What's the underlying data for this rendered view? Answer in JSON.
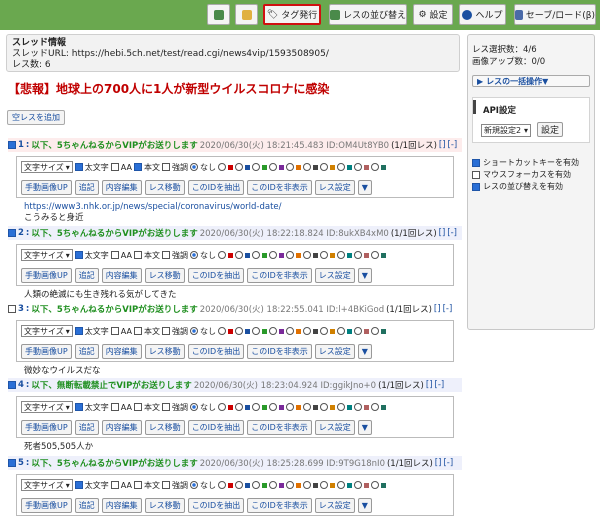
{
  "toolbar": {
    "items": [
      {
        "label": ""
      },
      {
        "label": ""
      },
      {
        "label": "タグ発行"
      },
      {
        "label": "レスの並び替え"
      },
      {
        "label": "設定"
      },
      {
        "label": "ヘルプ"
      },
      {
        "label": "セーブ/ロード(β)"
      }
    ]
  },
  "thread": {
    "info_title": "スレッド情報",
    "url_line": "スレッドURL: https://hebi.5ch.net/test/read.cgi/news4vip/1593508905/",
    "count_line": "レス数: 6",
    "title": "【悲報】地球上の700人に1人が新型ウイルスコロナに感染",
    "add_button": "空レスを追加"
  },
  "controls": {
    "font_select": "文字サイズ",
    "bold": "太文字",
    "aa": "AA",
    "honbun": "本文",
    "kyocho": "強調",
    "nashi": "なし",
    "buttons": [
      "手動画像UP",
      "追記",
      "内容編集",
      "レス移動",
      "このIDを抽出",
      "このIDを非表示",
      "レス設定"
    ],
    "more": "▼"
  },
  "colors": {
    "swatches": [
      "#cc0000",
      "#1a4fa0",
      "#2a9a2a",
      "#7a2a9a",
      "#e07000",
      "#444444",
      "#d08000",
      "#008080",
      "#b06060",
      "#207060"
    ]
  },
  "posts": [
    {
      "num": "1",
      "name": "以下、5ちゃんねるからVIPがお送りします",
      "datetime": "2020/06/30(火) 18:21:45.483 ID:OM4Ut8YB0",
      "rescount": "(1/1回レス)",
      "brackets": "[]",
      "minus": "[-]",
      "checked": true,
      "lines": [
        "https://www3.nhk.or.jp/news/special/coronavirus/world-date/",
        "こうみると身近"
      ]
    },
    {
      "num": "2",
      "name": "以下、5ちゃんねるからVIPがお送りします",
      "datetime": "2020/06/30(火) 18:22:18.824 ID:8ukXB4xM0",
      "rescount": "(1/1回レス)",
      "brackets": "[]",
      "minus": "[-]",
      "checked": true,
      "lines": [
        "人類の絶滅にも生き残れる気がしてきた"
      ]
    },
    {
      "num": "3",
      "name": "以下、5ちゃんねるからVIPがお送りします",
      "datetime": "2020/06/30(火) 18:22:55.041 ID:l+4BKiGod",
      "rescount": "(1/1回レス)",
      "brackets": "[]",
      "minus": "[-]",
      "checked": false,
      "lines": [
        "微妙なウイルスだな"
      ]
    },
    {
      "num": "4",
      "name": "以下、無断転載禁止でVIPがお送りします",
      "datetime": "2020/06/30(火) 18:23:04.924 ID:ggikJno+0",
      "rescount": "(1/1回レス)",
      "brackets": "[]",
      "minus": "[-]",
      "checked": true,
      "lines": [
        "死者505,505人か"
      ]
    },
    {
      "num": "5",
      "name": "以下、5ちゃんねるからVIPがお送りします",
      "datetime": "2020/06/30(火) 18:25:28.699 ID:9T9G18nI0",
      "rescount": "(1/1回レス)",
      "brackets": "[]",
      "minus": "[-]",
      "checked": true,
      "lines": []
    }
  ],
  "sidebar": {
    "selected": "レス選択数：4/6",
    "images": "画像アップ数：0/0",
    "bulk_button": "レスの一括操作▼",
    "api_title": "API設定",
    "api_select": "新規設定2",
    "api_button": "設定",
    "options": [
      {
        "label": "ショートカットキーを有効",
        "checked": true
      },
      {
        "label": "マウスフォーカスを有効",
        "checked": false
      },
      {
        "label": "レスの並び替えを有効",
        "checked": true
      }
    ]
  }
}
